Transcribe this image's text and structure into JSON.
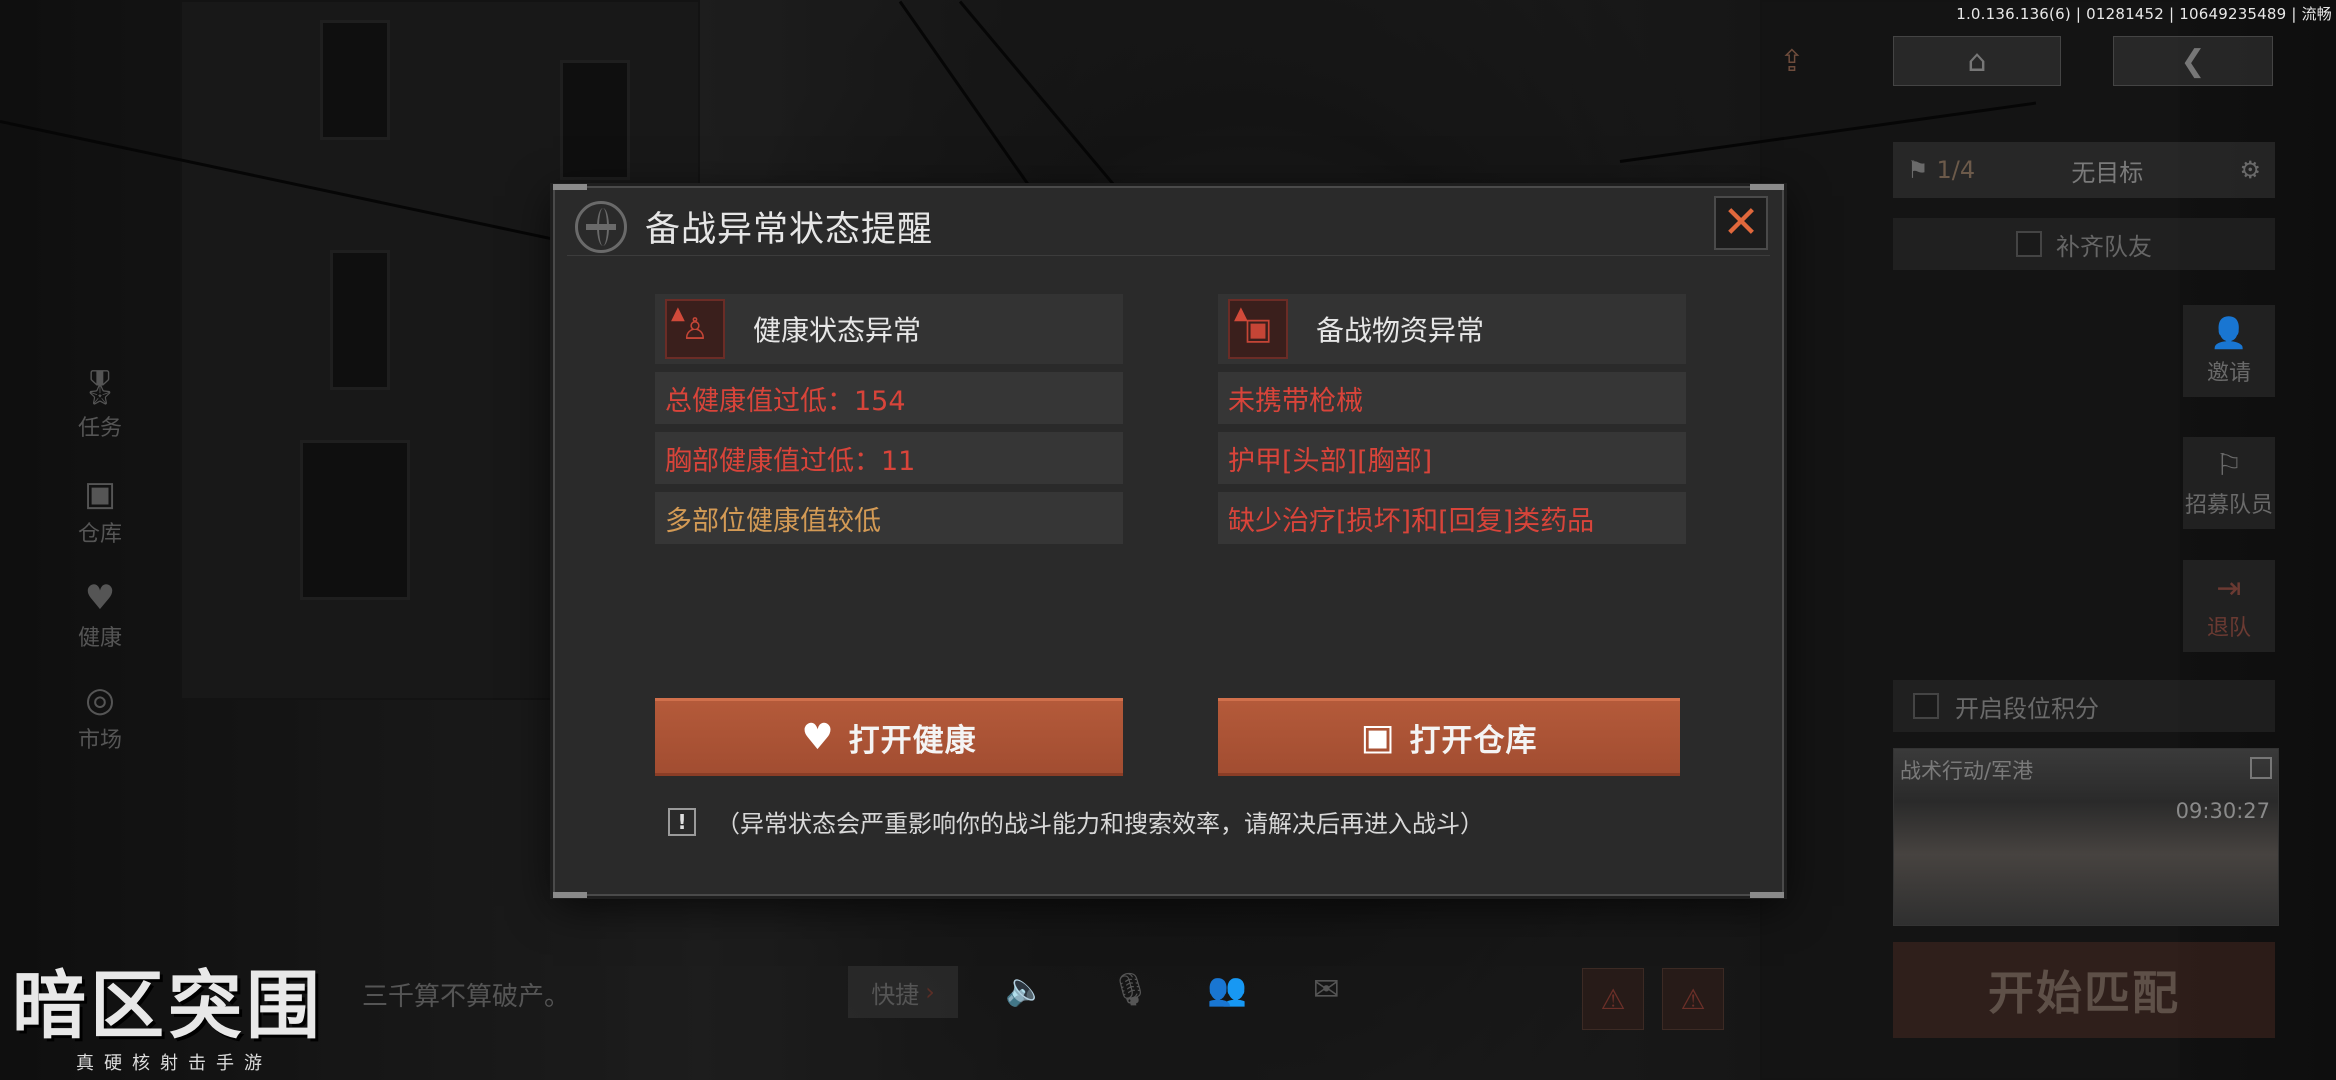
{
  "hud": {
    "version": "1.0.136.136(6) | 01281452 | 10649235489 | 流畅",
    "target_count": "1/4",
    "target_label": "无目标",
    "fill_team": "补齐队友",
    "invite": "邀请",
    "recruit": "招募队员",
    "leave": "退队",
    "ranked_points": "开启段位积分",
    "map_title": "战术行动/军港",
    "map_time": "09:30:27",
    "start_match": "开始匹配"
  },
  "left_menu": {
    "tasks": "任务",
    "storage": "仓库",
    "health": "健康",
    "market": "市场"
  },
  "bottom": {
    "logo_title": "暗区突围",
    "logo_sub": "真硬核射击手游",
    "slogan": "三千算不算破产。",
    "quick": "快捷"
  },
  "modal": {
    "title": "备战异常状态提醒",
    "close_symbol": "✕",
    "health": {
      "header": "健康状态异常",
      "rows": [
        "总健康值过低：154",
        "胸部健康值过低：11",
        "多部位健康值较低"
      ],
      "button": "打开健康"
    },
    "supplies": {
      "header": "备战物资异常",
      "rows": [
        "未携带枪械",
        "护甲[头部][胸部]",
        "缺少治疗[损坏]和[回复]类药品"
      ],
      "button": "打开仓库"
    },
    "notice": "（异常状态会严重影响你的战斗能力和搜索效率，请解决后再进入战斗）"
  },
  "colors": {
    "accent": "#a9522f",
    "danger_text": "#d8443a",
    "warning_text": "#d39a55",
    "close_x": "#e0683c"
  },
  "icons": [
    "globe-icon",
    "close-icon",
    "person-icon",
    "chest-icon",
    "heart-pulse-icon",
    "exclamation-icon",
    "home-icon",
    "back-arrow-icon",
    "share-icon",
    "gear-icon",
    "flag-icon",
    "medal-icon",
    "heart-icon",
    "coins-icon",
    "speaker-icon",
    "mic-icon",
    "friends-icon",
    "mail-icon"
  ]
}
